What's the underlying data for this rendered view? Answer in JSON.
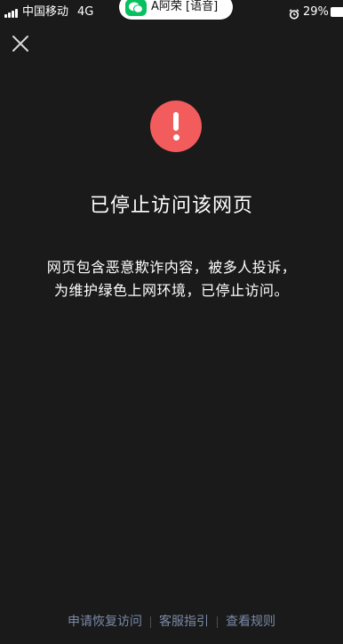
{
  "status_bar": {
    "carrier": "中国移动",
    "network": "4G",
    "voice_call": "A阿荣 [语音]",
    "battery": "29%",
    "icons": [
      "signal-icon",
      "wechat-icon",
      "alarm-icon",
      "battery-icon"
    ]
  },
  "close_icon": "close-icon",
  "warning": {
    "icon": "exclamation-icon",
    "color": "#f25c5c",
    "title": "已停止访问该网页",
    "message_lines": [
      "网页包含恶意欺诈内容，被多人投诉，",
      "为维护绿色上网环境，已停止访问。"
    ]
  },
  "footer": {
    "links": [
      "申请恢复访问",
      "客服指引",
      "查看规则"
    ],
    "link_color": "#7b8aa6"
  }
}
